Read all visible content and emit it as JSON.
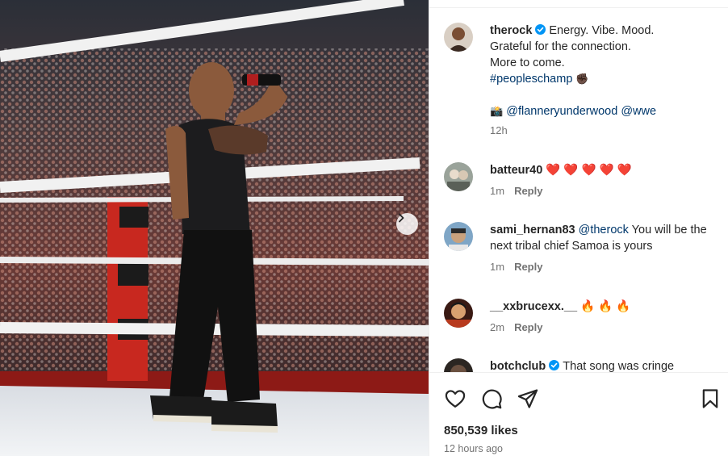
{
  "post": {
    "author": "therock",
    "caption_lines": [
      "Energy. Vibe. Mood.",
      "Grateful for the connection.",
      "More to come."
    ],
    "hashtag": "#peopleschamp",
    "hashtag_emoji": "✊🏿",
    "camera_emoji": "📸",
    "credits": [
      "@flanneryunderwood",
      "@wwe"
    ],
    "age": "12h",
    "image_alt": "Wrestler on stage holding microphone"
  },
  "comments": [
    {
      "user": "batteur40",
      "mention": "",
      "text": "❤️ ❤️ ❤️ ❤️ ❤️",
      "time": "1m",
      "reply": "Reply"
    },
    {
      "user": "sami_hernan83",
      "mention": "@therock",
      "text": " You will be the next tribal chief Samoa is yours",
      "time": "1m",
      "reply": "Reply"
    },
    {
      "user": "__xxbrucexx.__",
      "mention": "",
      "text": "🔥 🔥 🔥",
      "time": "2m",
      "reply": "Reply"
    },
    {
      "user": "botchclub",
      "mention": "",
      "text": "That song was cringe",
      "verified": true
    }
  ],
  "footer": {
    "likes": "850,539 likes",
    "posted": "12 hours ago"
  },
  "icons": {
    "like": "heart-icon",
    "comment": "comment-bubble-icon",
    "share": "paper-plane-icon",
    "save": "bookmark-icon",
    "next": "chevron-right-icon",
    "verified": "verified-badge-icon"
  },
  "colors": {
    "verified": "#0095f6",
    "mention": "#00376b",
    "muted": "#737373",
    "ring_red": "#c8281f"
  }
}
